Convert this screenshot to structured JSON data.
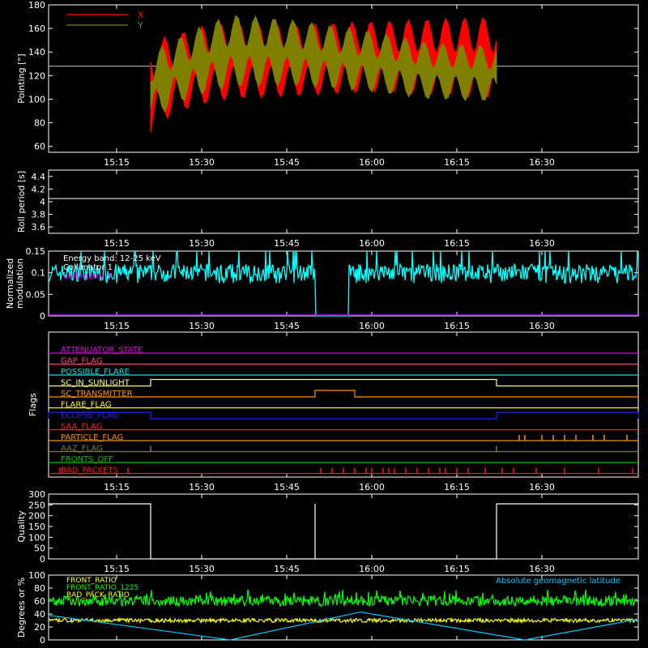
{
  "time_ticks": [
    "15:15",
    "15:30",
    "15:45",
    "16:00",
    "16:15",
    "16:30"
  ],
  "colors": {
    "background": "#000000",
    "axes": "#ffffff",
    "x_series": "#ff0000",
    "y_series": "#808000",
    "modulation": "#00ffff",
    "front_ratio": "#ffff00",
    "front_ratio_1225": "#00ff00",
    "latitude": "#00c8ff"
  },
  "chart_data": [
    {
      "type": "line",
      "panel": "pointing",
      "ylabel": "Pointing [\"]",
      "ylim": [
        55,
        180
      ],
      "yticks": [
        60,
        80,
        100,
        120,
        140,
        160,
        180
      ],
      "xlim": [
        "15:03",
        "16:47"
      ],
      "reference_line": 128,
      "data_window": [
        "15:21",
        "16:22"
      ],
      "series": [
        {
          "name": "X",
          "color": "#ff0000",
          "envelope": {
            "time": [
              "15:21",
              "15:25",
              "15:30",
              "15:35",
              "15:45",
              "16:00",
              "16:10",
              "16:22"
            ],
            "upper": [
              150,
              155,
              162,
              164,
              163,
              166,
              168,
              170
            ],
            "lower": [
              70,
              88,
              95,
              100,
              102,
              106,
              104,
              100
            ]
          }
        },
        {
          "name": "Y",
          "color": "#808000",
          "envelope": {
            "time": [
              "15:21",
              "15:25",
              "15:30",
              "15:35",
              "15:45",
              "16:00",
              "16:10",
              "16:22"
            ],
            "upper": [
              140,
              150,
              162,
              172,
              168,
              158,
              148,
              145
            ],
            "lower": [
              80,
              95,
              104,
              110,
              112,
              106,
              100,
              98
            ]
          }
        }
      ]
    },
    {
      "type": "line",
      "panel": "roll_period",
      "ylabel": "Roll period [s]",
      "ylim": [
        3.5,
        4.5
      ],
      "yticks": [
        3.6,
        3.8,
        4.0,
        4.2,
        4.4
      ],
      "series": [
        {
          "time": [
            "15:03",
            "16:47"
          ],
          "values": [
            4.05,
            4.05
          ]
        }
      ]
    },
    {
      "type": "line",
      "panel": "modulation",
      "ylabel": "Normalized modulation",
      "ylim": [
        0,
        0.15
      ],
      "yticks": [
        0.0,
        0.05,
        0.1,
        0.15
      ],
      "annotations": [
        "Energy band: 12-25 keV",
        "Collimator 1",
        "Collimator 7"
      ],
      "annotation_colors": [
        "#ffffff",
        "#ffffff",
        "#ff00ff"
      ],
      "baseline": 0.1,
      "noise": 0.02,
      "gap": [
        "15:50",
        "15:56"
      ]
    },
    {
      "type": "table",
      "panel": "flags",
      "ylabel": "Flags",
      "flags": [
        {
          "name": "ATTENUATOR_STATE",
          "color": "#e000e0",
          "segments": []
        },
        {
          "name": "GAP_FLAG",
          "color": "#ff4080",
          "segments": []
        },
        {
          "name": "POSSIBLE_FLARE",
          "color": "#00e0e0",
          "segments": []
        },
        {
          "name": "SC_IN_SUNLIGHT",
          "color": "#ffff80",
          "segments": [
            [
              "15:21",
              "16:22"
            ]
          ]
        },
        {
          "name": "SC_TRANSMITTER",
          "color": "#ff9000",
          "segments": [
            [
              "15:50",
              "15:57"
            ]
          ]
        },
        {
          "name": "FLARE_FLAG",
          "color": "#ffff00",
          "segments": []
        },
        {
          "name": "ECLIPSE_FLAG",
          "color": "#2020ff",
          "segments": [
            [
              "15:03",
              "15:21"
            ],
            [
              "16:22",
              "16:47"
            ]
          ]
        },
        {
          "name": "SAA_FLAG",
          "color": "#ff2020",
          "segments": []
        },
        {
          "name": "PARTICLE_FLAG",
          "color": "#ff8c00",
          "spikes": [
            "16:26",
            "16:27",
            "16:30",
            "16:32",
            "16:34",
            "16:36",
            "16:39",
            "16:41",
            "16:45"
          ]
        },
        {
          "name": "AAZ_FLAG",
          "color": "#808000",
          "spikes": [
            "15:21",
            "16:22"
          ]
        },
        {
          "name": "FRONTS_OFF",
          "color": "#00c000",
          "segments": []
        },
        {
          "name": "BAD_PACKETS",
          "color": "#ff1010",
          "spikes": [
            "15:05",
            "15:17",
            "15:51",
            "15:53",
            "15:55",
            "15:57",
            "15:59",
            "16:00",
            "16:02",
            "16:03",
            "16:04",
            "16:06",
            "16:08",
            "16:10",
            "16:12",
            "16:13",
            "16:15",
            "16:17",
            "16:20",
            "16:23",
            "16:25",
            "16:29",
            "16:34",
            "16:40",
            "16:46"
          ]
        }
      ]
    },
    {
      "type": "line",
      "panel": "quality",
      "ylabel": "Quality",
      "ylim": [
        0,
        300
      ],
      "yticks": [
        0,
        50,
        100,
        150,
        200,
        250,
        300
      ],
      "series": [
        {
          "time": [
            "15:03",
            "15:21",
            "15:21",
            "15:50",
            "15:50",
            "15:50",
            "15:50",
            "16:22",
            "16:22",
            "16:47"
          ],
          "values": [
            255,
            255,
            0,
            0,
            255,
            255,
            0,
            0,
            255,
            255
          ]
        }
      ]
    },
    {
      "type": "line",
      "panel": "ratios",
      "ylabel": "Degrees or %",
      "ylim": [
        0,
        100
      ],
      "yticks": [
        0,
        20,
        40,
        60,
        80,
        100
      ],
      "annotations": [
        "Absolute geomagnetic latitude"
      ],
      "series": [
        {
          "name": "FRONT_RATIO",
          "color": "#ffff00",
          "values": []
        },
        {
          "name": "FRONT_RATIO_1225",
          "color": "#00ff00",
          "level": 60,
          "noise": 8
        },
        {
          "name": "BAD_PACK_RATIO",
          "color": "#ffff00",
          "level": 30,
          "noise": 3
        },
        {
          "name": "Absolute geomagnetic latitude",
          "color": "#00c8ff",
          "time": [
            "15:03",
            "15:35",
            "15:58",
            "16:27",
            "16:47"
          ],
          "values": [
            38,
            0,
            43,
            0,
            32
          ]
        }
      ]
    }
  ]
}
